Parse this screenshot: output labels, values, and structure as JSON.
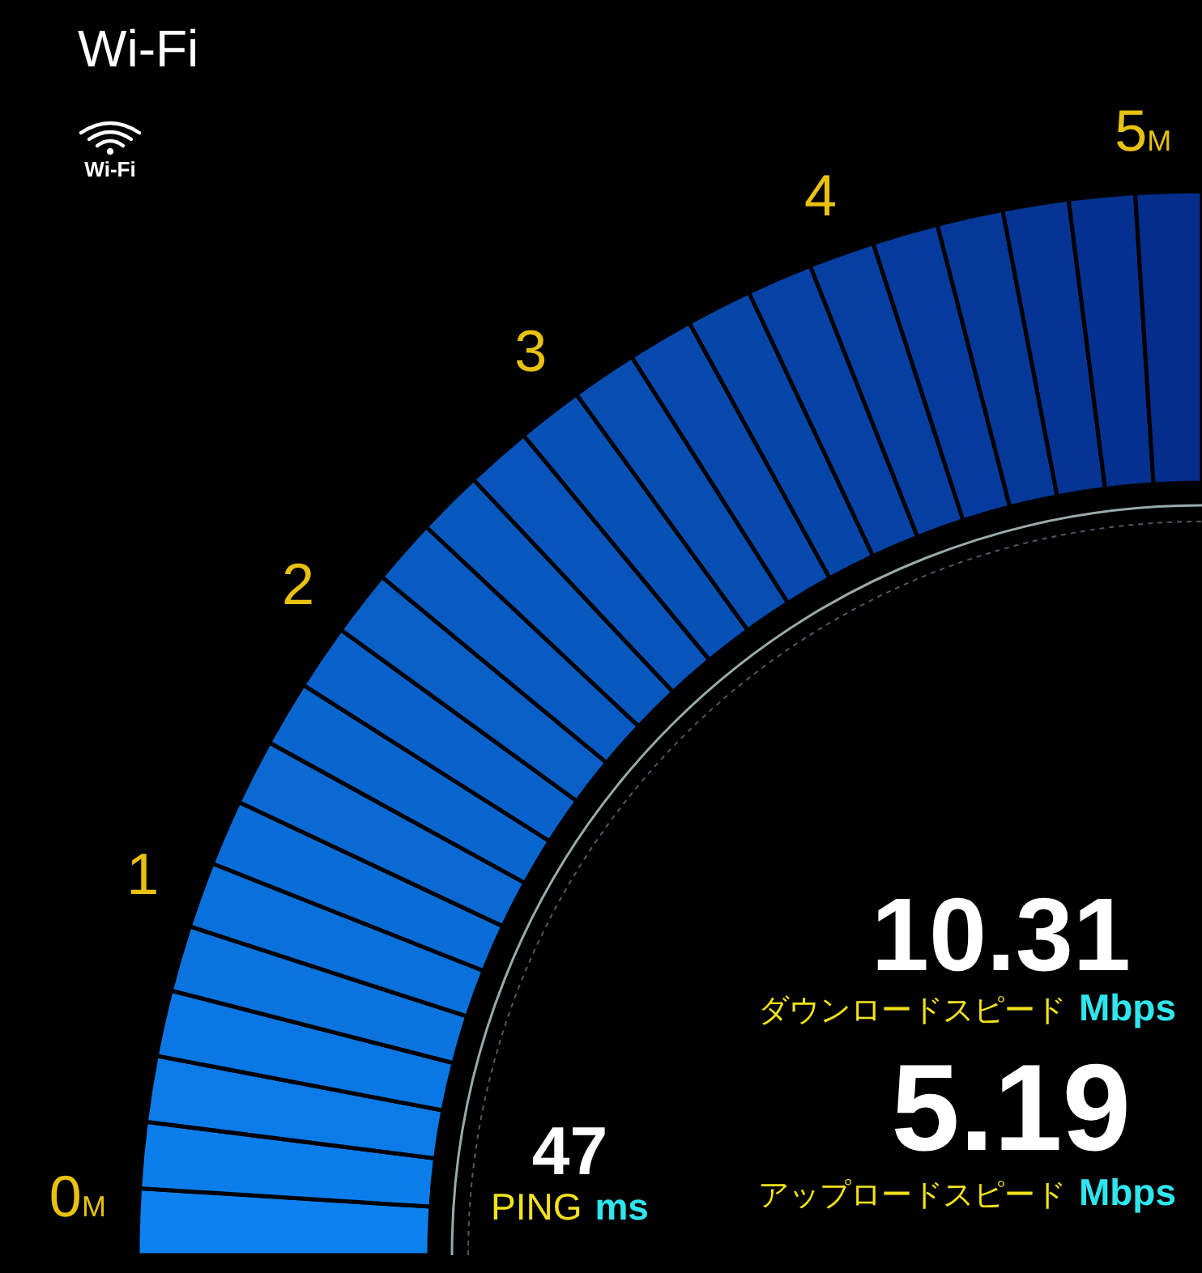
{
  "title": "Wi-Fi",
  "network_badge": {
    "label": "Wi-Fi"
  },
  "gauge": {
    "scale": [
      {
        "value": "0",
        "unit": "M"
      },
      {
        "value": "1"
      },
      {
        "value": "2"
      },
      {
        "value": "3"
      },
      {
        "value": "4"
      },
      {
        "value": "5",
        "unit": "M"
      }
    ]
  },
  "readouts": [
    {
      "kind": "speed",
      "value": "10.31",
      "label": "ダウンロードスピード",
      "unit": "Mbps"
    },
    {
      "kind": "ping",
      "value": "47",
      "label": "PING",
      "unit": "ms"
    },
    {
      "kind": "speed",
      "value": "5.19",
      "label": "アップロードスピード",
      "unit": "Mbps"
    }
  ]
}
